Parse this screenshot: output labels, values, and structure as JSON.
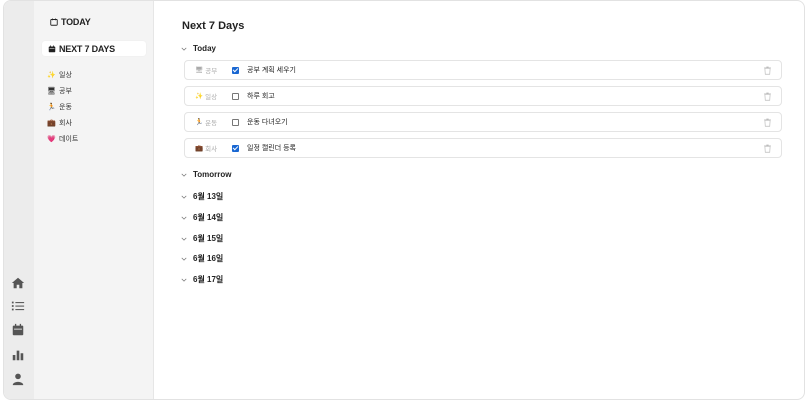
{
  "sidebar": {
    "today_label": "TODAY",
    "next7_label": "NEXT 7 DAYS",
    "categories": [
      {
        "emoji": "✨",
        "label": "일상"
      },
      {
        "emoji": "🖥",
        "label": "공부"
      },
      {
        "emoji": "🏃",
        "label": "운동"
      },
      {
        "emoji": "💼",
        "label": "회사"
      },
      {
        "emoji": "💗",
        "label": "데이트"
      }
    ]
  },
  "main": {
    "title": "Next 7 Days",
    "today_section": "Today",
    "tasks": [
      {
        "cat_emoji": "🖥",
        "cat": "공부",
        "text": "공부 계획 세우기",
        "checked": true
      },
      {
        "cat_emoji": "✨",
        "cat": "일상",
        "text": "하루 회고",
        "checked": false
      },
      {
        "cat_emoji": "🏃",
        "cat": "운동",
        "text": "운동 다녀오기",
        "checked": false
      },
      {
        "cat_emoji": "💼",
        "cat": "회사",
        "text": "일정 캘린더 등록",
        "checked": true
      }
    ],
    "sections": [
      "Tomorrow",
      "6월 13일",
      "6월 14일",
      "6월 15일",
      "6월 16일",
      "6월 17일"
    ]
  },
  "colors": {
    "checkbox_checked": "#1967d2",
    "sidebar_bg": "#f4f4f4",
    "iconbar_bg": "#ececec"
  },
  "iconbar": [
    "home-icon",
    "list-icon",
    "calendar-icon",
    "chart-icon",
    "user-icon"
  ]
}
